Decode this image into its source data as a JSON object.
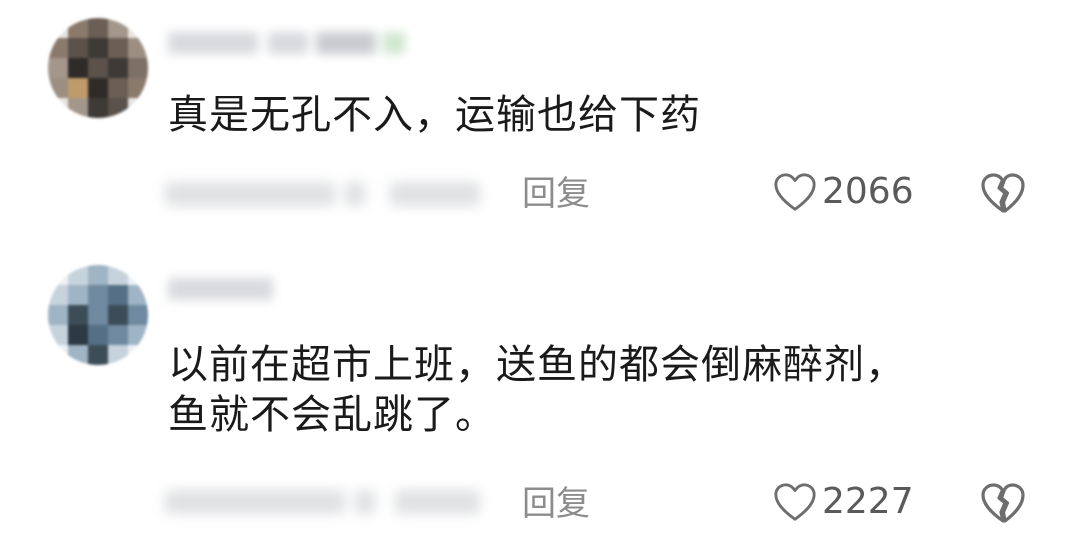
{
  "comments": [
    {
      "text_lines": [
        "真是无孔不入，运输也给下药"
      ],
      "reply_label": "回复",
      "like_count": "2066",
      "avatar_colors": [
        "#6b5f55",
        "#3e3a36",
        "#8a7a6c",
        "#2f2b28",
        "#a3978b",
        "#5a524b"
      ],
      "icons": {
        "like": "heart-outline-icon",
        "dislike": "broken-heart-icon"
      }
    },
    {
      "text_lines": [
        "以前在超市上班，送鱼的都会倒麻醉剂，",
        "鱼就不会乱跳了。"
      ],
      "reply_label": "回复",
      "like_count": "2227",
      "avatar_colors": [
        "#6f8aa0",
        "#3c4d58",
        "#9fb4c4",
        "#2c3a44",
        "#c7d3dc",
        "#557086"
      ],
      "icons": {
        "like": "heart-outline-icon",
        "dislike": "broken-heart-icon"
      }
    }
  ],
  "colors": {
    "text": "#1a1a1a",
    "secondary": "#8c8c8c",
    "icon": "#6e6e6e",
    "background": "#ffffff"
  }
}
